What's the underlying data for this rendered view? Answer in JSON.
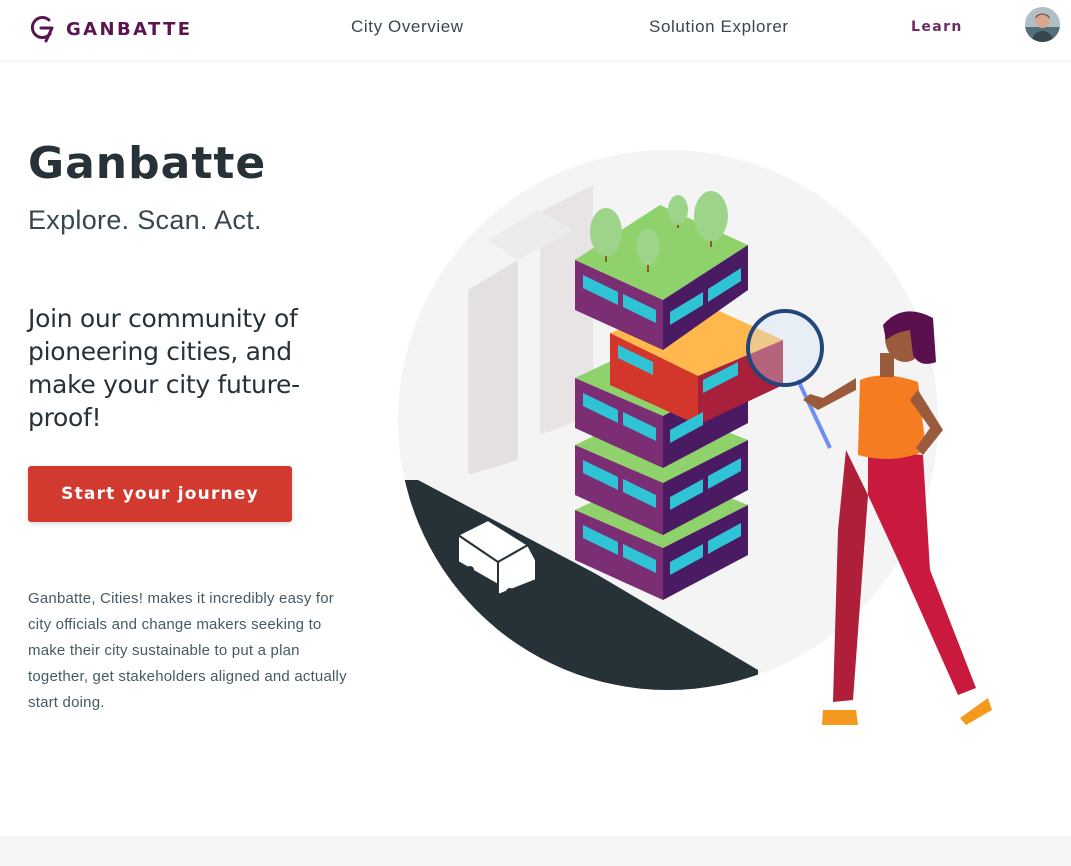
{
  "header": {
    "brand": "GANBATTE",
    "nav": {
      "city_overview": "City Overview",
      "solution_explorer": "Solution Explorer",
      "learn": "Learn"
    }
  },
  "hero": {
    "title": "Ganbatte",
    "tagline": "Explore. Scan. Act.",
    "pitch": "Join our community of pioneering cities, and make your city future-proof!",
    "cta_label": "Start your journey",
    "description": "Ganbatte, Cities! makes it incredibly easy for city officials and change makers seeking to make their city sustainable to put a plan together, get stakeholders aligned and actually start doing."
  },
  "colors": {
    "brand": "#5a1450",
    "cta": "#d23a2f",
    "text": "#263238"
  },
  "icons": {
    "logo": "ganbatte-logo-icon",
    "avatar": "user-avatar"
  }
}
